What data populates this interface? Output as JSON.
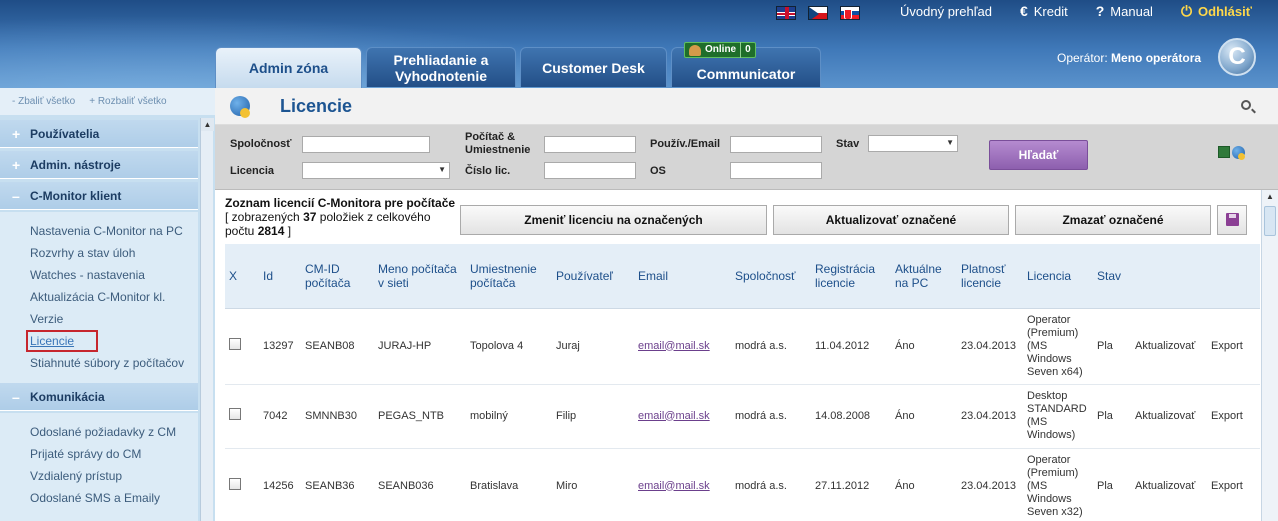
{
  "header": {
    "flags": [
      "uk-flag-icon",
      "cz-flag-icon",
      "sk-flag-icon"
    ],
    "nav": {
      "overview": "Úvodný prehľad",
      "credit": "Kredit",
      "manual": "Manual",
      "logout": "Odhlásiť"
    },
    "tabs": [
      {
        "label": "Admin zóna",
        "active": true
      },
      {
        "label": "Prehliadanie a Vyhodnotenie",
        "active": false
      },
      {
        "label": "Customer Desk",
        "active": false
      },
      {
        "label": "Communicator",
        "active": false
      }
    ],
    "online_label": "Online",
    "online_count": "0",
    "operator_label": "Operátor:",
    "operator_name": "Meno operátora",
    "logo_letter": "C"
  },
  "sidebar": {
    "collapse_all": "- Zbaliť všetko",
    "expand_all": "+ Rozbaliť všetko",
    "sections": [
      {
        "label": "Používatelia",
        "sign": "+"
      },
      {
        "label": "Admin. nástroje",
        "sign": "+"
      },
      {
        "label": "C-Monitor klient",
        "sign": "–"
      },
      {
        "label": "Komunikácia",
        "sign": "–"
      }
    ],
    "cmonitor_links": [
      "Nastavenia C-Monitor na PC",
      "Rozvrhy a stav úloh",
      "Watches - nastavenia",
      "Aktualizácia C-Monitor kl.",
      "Verzie",
      "Licencie",
      "Stiahnuté súbory z počítačov"
    ],
    "komunikacia_links": [
      "Odoslané požiadavky z CM",
      "Prijaté správy do CM",
      "Vzdialený prístup",
      "Odoslané SMS a Emaily"
    ]
  },
  "page": {
    "title": "Licencie"
  },
  "filter": {
    "company_label": "Spoločnosť",
    "computer_label": "Počítač & Umiestnenie",
    "user_label": "Použív./Email",
    "state_label": "Stav",
    "license_label": "Licencia",
    "lic_number_label": "Číslo lic.",
    "os_label": "OS",
    "search_button": "Hľadať"
  },
  "list": {
    "title": "Zoznam licencií C-Monitora pre počítače",
    "shown_prefix": "[ zobrazených",
    "shown_count": "37",
    "shown_mid": "položiek z celkového počtu",
    "total_count": "2814",
    "shown_suffix": "]",
    "btn_change": "Zmeniť licenciu na označených",
    "btn_update": "Aktualizovať označené",
    "btn_delete": "Zmazať označené"
  },
  "table": {
    "headers": [
      "X",
      "Id",
      "CM-ID počítača",
      "Meno počítača v sieti",
      "Umiestnenie počítača",
      "Používateľ",
      "Email",
      "Spoločnosť",
      "Registrácia licencie",
      "Aktuálne na PC",
      "Platnosť licencie",
      "Licencia",
      "Stav",
      "",
      ""
    ],
    "rows": [
      {
        "id": "13297",
        "cmid": "SEANB08",
        "name": "JURAJ-HP",
        "location": "Topolova 4",
        "user": "Juraj",
        "email": "email@mail.sk",
        "company": "modrá a.s.",
        "registered": "11.04.2012",
        "current": "Áno",
        "valid": "23.04.2013",
        "license": "Operator (Premium) (MS Windows Seven x64)",
        "state": "Pla",
        "update": "Aktualizovať",
        "export": "Export"
      },
      {
        "id": "7042",
        "cmid": "SMNNB30",
        "name": "PEGAS_NTB",
        "location": "mobilný",
        "user": "Filip",
        "email": "email@mail.sk",
        "company": "modrá a.s.",
        "registered": "14.08.2008",
        "current": "Áno",
        "valid": "23.04.2013",
        "license": "Desktop STANDARD (MS Windows)",
        "state": "Pla",
        "update": "Aktualizovať",
        "export": "Export"
      },
      {
        "id": "14256",
        "cmid": "SEANB36",
        "name": "SEANB036",
        "location": "Bratislava",
        "user": "Miro",
        "email": "email@mail.sk",
        "company": "modrá a.s.",
        "registered": "27.11.2012",
        "current": "Áno",
        "valid": "23.04.2013",
        "license": "Operator (Premium) (MS Windows Seven x32)",
        "state": "Pla",
        "update": "Aktualizovať",
        "export": "Export"
      }
    ]
  },
  "colors": {
    "header_blue": "#2f65a3",
    "sidebar_blue": "#c7dff0",
    "title_blue": "#1d5592",
    "search_purple": "#8d5fae",
    "highlight_red": "#c6262e"
  }
}
